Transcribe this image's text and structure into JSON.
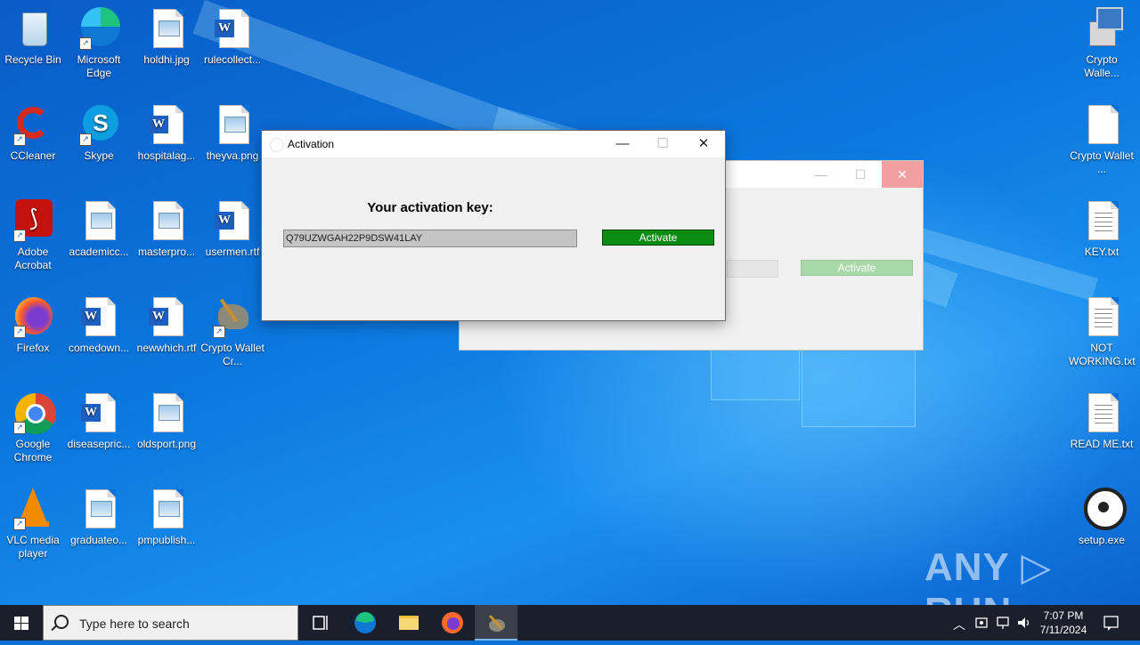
{
  "desktop": {
    "icons": [
      {
        "label": "Recycle Bin"
      },
      {
        "label": "Microsoft Edge"
      },
      {
        "label": "holdhi.jpg"
      },
      {
        "label": "rulecollect..."
      },
      {
        "label": "CCleaner"
      },
      {
        "label": "Skype"
      },
      {
        "label": "hospitalag..."
      },
      {
        "label": "theyva.png"
      },
      {
        "label": "Adobe Acrobat"
      },
      {
        "label": "academicc..."
      },
      {
        "label": "masterpro..."
      },
      {
        "label": "usermen.rtf"
      },
      {
        "label": "Firefox"
      },
      {
        "label": "comedown..."
      },
      {
        "label": "newwhich.rtf"
      },
      {
        "label": "Crypto Wallet Cr..."
      },
      {
        "label": "Google Chrome"
      },
      {
        "label": "diseasepric..."
      },
      {
        "label": "oldsport.png"
      },
      {
        "label": "VLC media player"
      },
      {
        "label": "graduateo..."
      },
      {
        "label": "pmpublish..."
      },
      {
        "label": "Crypto Walle..."
      },
      {
        "label": "Crypto Wallet ..."
      },
      {
        "label": "KEY.txt"
      },
      {
        "label": "NOT WORKING.txt"
      },
      {
        "label": "READ ME.txt"
      },
      {
        "label": "setup.exe"
      }
    ]
  },
  "background_window": {
    "activate_label": "Activate"
  },
  "activation_window": {
    "title": "Activation",
    "heading": "Your activation key:",
    "key": "Q79UZWGAH22P9DSW41LAY",
    "activate_label": "Activate",
    "minimize": "—",
    "maximize": "☐",
    "close": "✕"
  },
  "watermark": "ANY ▷ RUN",
  "taskbar": {
    "search_placeholder": "Type here to search",
    "time": "7:07 PM",
    "date": "7/11/2024"
  },
  "colors": {
    "activate_green": "#0a8c12",
    "desktop_blue": "#0a6fd6"
  }
}
